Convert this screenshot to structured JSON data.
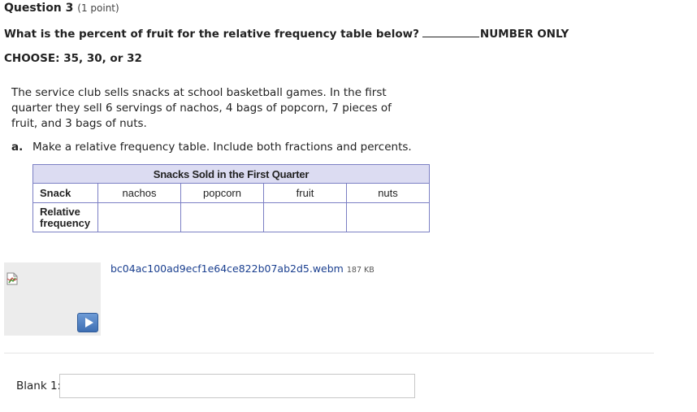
{
  "question": {
    "title": "Question 3",
    "points": "(1 point)",
    "prompt": "What is the percent of fruit for the relative frequency table below?",
    "prompt_suffix": "NUMBER ONLY",
    "choose": "CHOOSE: 35, 30, or 32"
  },
  "problem": {
    "text": "The service club sells snacks at school basketball games. In the first quarter they sell 6 servings of nachos, 4 bags of popcorn, 7 pieces of fruit, and 3 bags of nuts.",
    "part_a_letter": "a.",
    "part_a_text": "Make a relative frequency table. Include both fractions and percents."
  },
  "table": {
    "caption": "Snacks Sold in the First Quarter",
    "row1_header": "Snack",
    "row2_header_line1": "Relative",
    "row2_header_line2": "frequency",
    "columns": [
      "nachos",
      "popcorn",
      "fruit",
      "nuts"
    ],
    "relative_frequency": [
      "",
      "",
      "",
      ""
    ]
  },
  "attachment": {
    "filename": "bc04ac100ad9ecf1e64ce822b07ab2d5.webm",
    "size": "187 KB"
  },
  "answer": {
    "label": "Blank 1:",
    "value": "",
    "placeholder": ""
  },
  "colors": {
    "table_border": "#7b7fc4",
    "table_header_bg": "#dcdcf2",
    "link": "#1a3f8f",
    "play_button": "#3e6fb3"
  }
}
